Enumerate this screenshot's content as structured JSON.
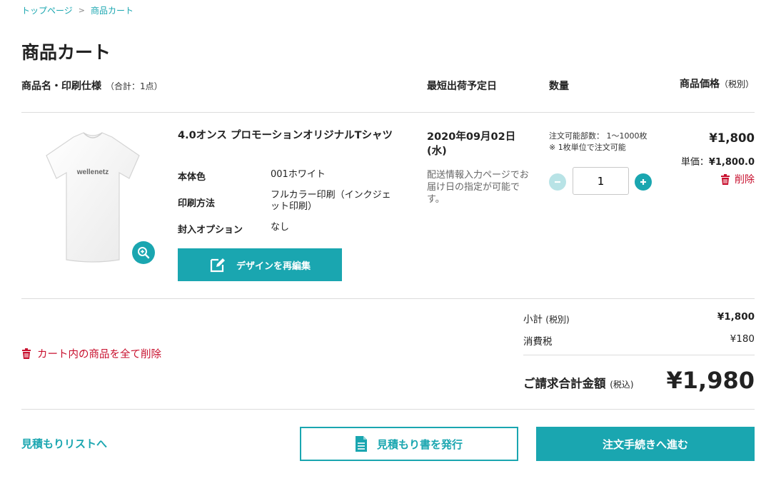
{
  "breadcrumb": {
    "home": "トップページ",
    "separator": ">",
    "current": "商品カート"
  },
  "page_title": "商品カート",
  "headers": {
    "product": "商品名・印刷仕様",
    "count": "（合計：1点）",
    "ship": "最短出荷予定日",
    "qty": "数量",
    "price": "商品価格",
    "price_tax": "（税別）"
  },
  "item": {
    "name": "4.0オンス プロモーションオリジナルTシャツ",
    "image_text": "wellenetz",
    "specs": [
      {
        "label": "本体色",
        "value": "001ホワイト"
      },
      {
        "label": "印刷方法",
        "value": "フルカラー印刷（インクジェット印刷）"
      },
      {
        "label": "封入オプション",
        "value": "なし"
      }
    ],
    "edit_label": "デザインを再編集",
    "ship_date": "2020年09月02日(水)",
    "ship_note": "配送情報入力ページでお届け日の指定が可能です。",
    "qty_note_1": "注文可能部数： 1〜1000枚",
    "qty_note_2": "※ 1枚単位で注文可能",
    "qty_value": "1",
    "price": "¥1,800",
    "unit_label": "単価：",
    "unit_price": "¥1,800.0",
    "delete_label": "削除"
  },
  "summary": {
    "subtotal_label": "小計",
    "subtotal_tax": "(税別)",
    "subtotal_value": "¥1,800",
    "tax_label": "消費税",
    "tax_value": "¥180",
    "total_label": "ご請求合計金額",
    "total_tax": "(税込)",
    "total_value": "¥1,980"
  },
  "delete_all_label": "カート内の商品を全て削除",
  "footer": {
    "estimate_list": "見積もりリストへ",
    "issue_estimate": "見積もり書を発行",
    "checkout": "注文手続きへ進む"
  },
  "colors": {
    "accent": "#1aa6b0",
    "danger": "#c8102e"
  }
}
